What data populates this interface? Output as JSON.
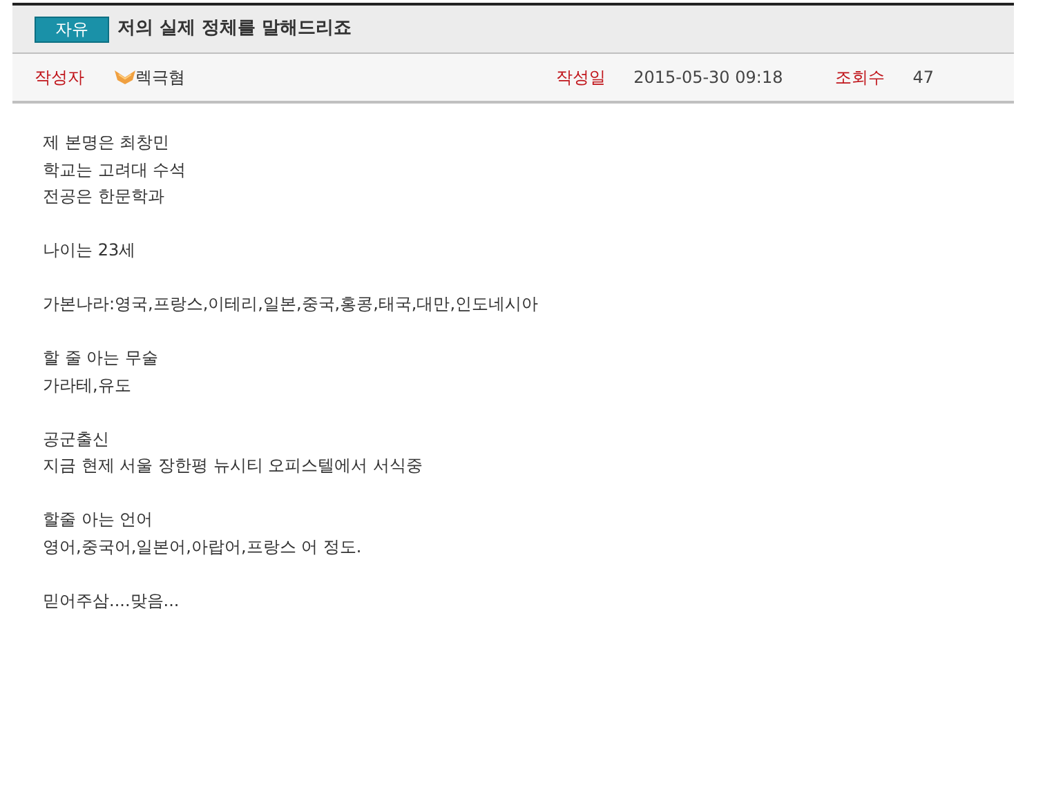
{
  "post": {
    "category": "자유",
    "title": "저의 실제 정체를 말해드리죠"
  },
  "meta": [
    {
      "label": "작성자",
      "value": "렉극혐",
      "kind": "author"
    },
    {
      "label": "작성일",
      "value": "2015-05-30 09:18",
      "kind": "text"
    },
    {
      "label": "조회수",
      "value": "47",
      "kind": "text"
    }
  ],
  "body": [
    [
      "제 본명은 최창민",
      "학교는 고려대 수석",
      "전공은 한문학과"
    ],
    [
      "나이는 23세"
    ],
    [
      "가본나라:영국,프랑스,이테리,일본,중국,홍콩,태국,대만,인도네시아"
    ],
    [
      "할 줄 아는 무술",
      "가라테,유도"
    ],
    [
      "공군출신",
      "지금 현제 서울 장한평 뉴시티 오피스텔에서 서식중"
    ],
    [
      "할줄 아는 언어",
      "영어,중국어,일본어,아랍어,프랑스 어 정도."
    ],
    [
      "믿어주삼....맞음..."
    ]
  ]
}
